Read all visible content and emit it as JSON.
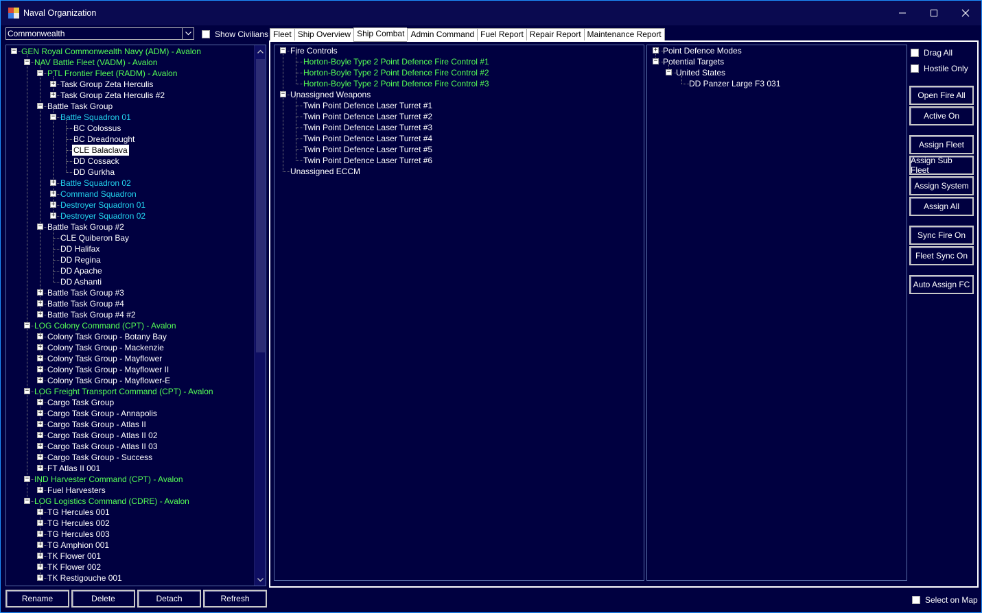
{
  "window": {
    "title": "Naval Organization"
  },
  "left": {
    "combo_value": "Commonwealth",
    "show_civilians": "Show Civilians",
    "tree": [
      {
        "text": "GEN Royal Commonwealth Navy  (ADM)  -  Avalon",
        "color": "green",
        "level": 0,
        "exp": "-"
      },
      {
        "text": "NAV Battle Fleet  (VADM)  -  Avalon",
        "color": "green",
        "level": 1,
        "exp": "-"
      },
      {
        "text": "PTL Frontier Fleet  (RADM)  -  Avalon",
        "color": "green",
        "level": 2,
        "exp": "-"
      },
      {
        "text": "Task Group Zeta Herculis",
        "color": "white",
        "level": 3,
        "exp": "+"
      },
      {
        "text": "Task Group Zeta Herculis #2",
        "color": "white",
        "level": 3,
        "exp": "+"
      },
      {
        "text": "Battle Task Group",
        "color": "white",
        "level": 2,
        "exp": "-"
      },
      {
        "text": "Battle Squadron 01",
        "color": "cyan",
        "level": 3,
        "exp": "-"
      },
      {
        "text": "BC Colossus",
        "color": "white",
        "level": 4,
        "exp": ""
      },
      {
        "text": "BC Dreadnought",
        "color": "white",
        "level": 4,
        "exp": ""
      },
      {
        "text": "CLE Balaclava",
        "color": "white",
        "level": 4,
        "exp": "",
        "selected": true
      },
      {
        "text": "DD Cossack",
        "color": "white",
        "level": 4,
        "exp": ""
      },
      {
        "text": "DD Gurkha",
        "color": "white",
        "level": 4,
        "exp": ""
      },
      {
        "text": "Battle Squadron 02",
        "color": "cyan",
        "level": 3,
        "exp": "+"
      },
      {
        "text": "Command Squadron",
        "color": "cyan",
        "level": 3,
        "exp": "+"
      },
      {
        "text": "Destroyer Squadron 01",
        "color": "cyan",
        "level": 3,
        "exp": "+"
      },
      {
        "text": "Destroyer Squadron 02",
        "color": "cyan",
        "level": 3,
        "exp": "+"
      },
      {
        "text": "Battle Task Group #2",
        "color": "white",
        "level": 2,
        "exp": "-"
      },
      {
        "text": "CLE Quiberon Bay",
        "color": "white",
        "level": 3,
        "exp": ""
      },
      {
        "text": "DD Halifax",
        "color": "white",
        "level": 3,
        "exp": ""
      },
      {
        "text": "DD Regina",
        "color": "white",
        "level": 3,
        "exp": ""
      },
      {
        "text": "DD Apache",
        "color": "white",
        "level": 3,
        "exp": ""
      },
      {
        "text": "DD Ashanti",
        "color": "white",
        "level": 3,
        "exp": ""
      },
      {
        "text": "Battle Task Group #3",
        "color": "white",
        "level": 2,
        "exp": "+"
      },
      {
        "text": "Battle Task Group #4",
        "color": "white",
        "level": 2,
        "exp": "+"
      },
      {
        "text": "Battle Task Group #4 #2",
        "color": "white",
        "level": 2,
        "exp": "+"
      },
      {
        "text": "LOG Colony Command  (CPT)  -  Avalon",
        "color": "green",
        "level": 1,
        "exp": "-"
      },
      {
        "text": "Colony Task Group - Botany Bay",
        "color": "white",
        "level": 2,
        "exp": "+"
      },
      {
        "text": "Colony Task Group - Mackenzie",
        "color": "white",
        "level": 2,
        "exp": "+"
      },
      {
        "text": "Colony Task Group - Mayflower",
        "color": "white",
        "level": 2,
        "exp": "+"
      },
      {
        "text": "Colony Task Group - Mayflower II",
        "color": "white",
        "level": 2,
        "exp": "+"
      },
      {
        "text": "Colony Task Group - Mayflower-E",
        "color": "white",
        "level": 2,
        "exp": "+"
      },
      {
        "text": "LOG Freight Transport Command  (CPT)  -  Avalon",
        "color": "green",
        "level": 1,
        "exp": "-"
      },
      {
        "text": "Cargo Task Group",
        "color": "white",
        "level": 2,
        "exp": "+"
      },
      {
        "text": "Cargo Task Group - Annapolis",
        "color": "white",
        "level": 2,
        "exp": "+"
      },
      {
        "text": "Cargo Task Group - Atlas II",
        "color": "white",
        "level": 2,
        "exp": "+"
      },
      {
        "text": "Cargo Task Group - Atlas II 02",
        "color": "white",
        "level": 2,
        "exp": "+"
      },
      {
        "text": "Cargo Task Group - Atlas II 03",
        "color": "white",
        "level": 2,
        "exp": "+"
      },
      {
        "text": "Cargo Task Group - Success",
        "color": "white",
        "level": 2,
        "exp": "+"
      },
      {
        "text": "FT Atlas II 001",
        "color": "white",
        "level": 2,
        "exp": "+"
      },
      {
        "text": "IND Harvester Command  (CPT)  -  Avalon",
        "color": "green",
        "level": 1,
        "exp": "-"
      },
      {
        "text": "Fuel Harvesters",
        "color": "white",
        "level": 2,
        "exp": "+"
      },
      {
        "text": "LOG Logistics Command  (CDRE)  -  Avalon",
        "color": "green",
        "level": 1,
        "exp": "-"
      },
      {
        "text": "TG Hercules 001",
        "color": "white",
        "level": 2,
        "exp": "+"
      },
      {
        "text": "TG Hercules 002",
        "color": "white",
        "level": 2,
        "exp": "+"
      },
      {
        "text": "TG Hercules 003",
        "color": "white",
        "level": 2,
        "exp": "+"
      },
      {
        "text": "TG Amphion 001",
        "color": "white",
        "level": 2,
        "exp": "+"
      },
      {
        "text": "TK Flower 001",
        "color": "white",
        "level": 2,
        "exp": "+"
      },
      {
        "text": "TK Flower 002",
        "color": "white",
        "level": 2,
        "exp": "+"
      },
      {
        "text": "TK Restigouche 001",
        "color": "white",
        "level": 2,
        "exp": "+"
      }
    ],
    "buttons": {
      "rename": "Rename",
      "delete": "Delete",
      "detach": "Detach",
      "refresh": "Refresh"
    }
  },
  "tabs": [
    "Fleet",
    "Ship Overview",
    "Ship Combat",
    "Admin Command",
    "Fuel Report",
    "Repair Report",
    "Maintenance Report"
  ],
  "active_tab": "Ship Combat",
  "combat_tree": [
    {
      "text": "Fire Controls",
      "color": "white",
      "level": 0,
      "exp": "-"
    },
    {
      "text": "Horton-Boyle Type 2 Point Defence Fire Control #1",
      "color": "green",
      "level": 1,
      "exp": ""
    },
    {
      "text": "Horton-Boyle Type 2 Point Defence Fire Control #2",
      "color": "green",
      "level": 1,
      "exp": ""
    },
    {
      "text": "Horton-Boyle Type 2 Point Defence Fire Control #3",
      "color": "green",
      "level": 1,
      "exp": ""
    },
    {
      "text": "Unassigned Weapons",
      "color": "white",
      "level": 0,
      "exp": "-"
    },
    {
      "text": "Twin Point Defence Laser Turret #1",
      "color": "white",
      "level": 1,
      "exp": ""
    },
    {
      "text": "Twin Point Defence Laser Turret #2",
      "color": "white",
      "level": 1,
      "exp": ""
    },
    {
      "text": "Twin Point Defence Laser Turret #3",
      "color": "white",
      "level": 1,
      "exp": ""
    },
    {
      "text": "Twin Point Defence Laser Turret #4",
      "color": "white",
      "level": 1,
      "exp": ""
    },
    {
      "text": "Twin Point Defence Laser Turret #5",
      "color": "white",
      "level": 1,
      "exp": ""
    },
    {
      "text": "Twin Point Defence Laser Turret #6",
      "color": "white",
      "level": 1,
      "exp": ""
    },
    {
      "text": "Unassigned ECCM",
      "color": "white",
      "level": 0,
      "exp": ""
    }
  ],
  "target_tree": [
    {
      "text": "Point Defence Modes",
      "color": "white",
      "level": 0,
      "exp": "+"
    },
    {
      "text": "Potential Targets",
      "color": "white",
      "level": 0,
      "exp": "-"
    },
    {
      "text": "United States",
      "color": "white",
      "level": 1,
      "exp": "-"
    },
    {
      "text": "DD Panzer Large F3 031",
      "color": "white",
      "level": 2,
      "exp": ""
    }
  ],
  "right": {
    "drag_all": "Drag All",
    "hostile_only": "Hostile Only",
    "buttons": [
      "Open Fire All",
      "Active On",
      "Assign Fleet",
      "Assign Sub Fleet",
      "Assign System",
      "Assign All",
      "Sync Fire On",
      "Fleet Sync On",
      "Auto Assign FC"
    ],
    "select_on_map": "Select on Map"
  },
  "colors": {
    "background": "#000040",
    "green": "#55ff55",
    "cyan": "#22d3ee"
  }
}
